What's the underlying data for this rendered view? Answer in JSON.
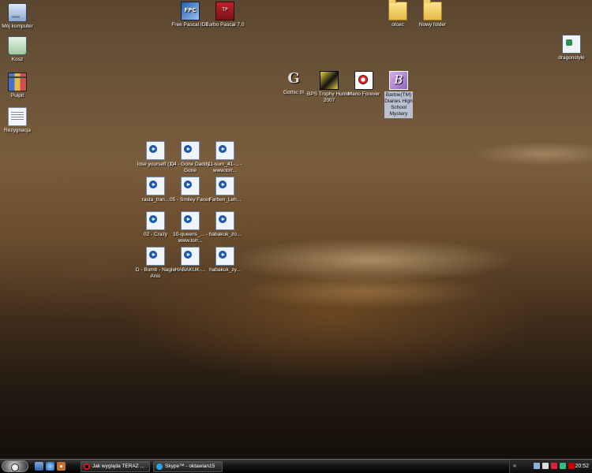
{
  "desktop_icons": [
    {
      "label": "Mój komputer",
      "icon": "computer-icon"
    },
    {
      "label": "Kosz",
      "icon": "recycle-bin-icon"
    },
    {
      "label": "Pulpit",
      "icon": "desktop-icon"
    },
    {
      "label": "Rezygnacja",
      "icon": "document-icon"
    },
    {
      "label": "Free Pascal IDE",
      "icon": "free-pascal-icon"
    },
    {
      "label": "Turbo Pascal 7.0",
      "icon": "turbo-pascal-icon"
    },
    {
      "label": "otcec",
      "icon": "folder-icon"
    },
    {
      "label": "Nowy folder",
      "icon": "folder-icon"
    },
    {
      "label": "dragonstyle",
      "icon": "dragonstyle-icon"
    },
    {
      "label": "Gothic III",
      "icon": "gothic-icon"
    },
    {
      "label": "BPS Trophy Hunter 2007",
      "icon": "bps-trophy-hunter-icon"
    },
    {
      "label": "Mario Forever",
      "icon": "mario-forever-icon"
    },
    {
      "label": "Barbie(TM) Diaries High School Mystery",
      "icon": "barbie-icon",
      "selected": true
    }
  ],
  "media_files": [
    "lose yourself (1)",
    "04 - Gone Daddy Gone",
    "11-sum_41-... - www.torr...",
    "rasta_tran...",
    "05 - Smiley Faces",
    "Farben_Leh...",
    "02 - Crazy",
    "10-queens_... - www.torr...",
    "habakuk_zo...",
    "D - Bomb - Nagle Anio",
    "HABAKUK-...",
    "habakuk_zy..."
  ],
  "taskbar": {
    "quick_launch": [
      "show-desktop-icon",
      "internet-explorer-icon",
      "media-player-icon"
    ],
    "tasks": [
      {
        "label": "Jak wygląda TERAZ ...",
        "icon": "opera-icon"
      },
      {
        "label": "Skype™ - oktawian15",
        "icon": "skype-icon"
      }
    ],
    "tray_icons": [
      "network-icon",
      "volume-icon",
      "antivirus-icon",
      "shield-icon",
      "kaspersky-icon"
    ],
    "clock": "20:52"
  },
  "colors": {
    "taskbar_bg": "#141414",
    "selection_bg": "#b9c0cf",
    "icon_text": "#ffffff"
  }
}
